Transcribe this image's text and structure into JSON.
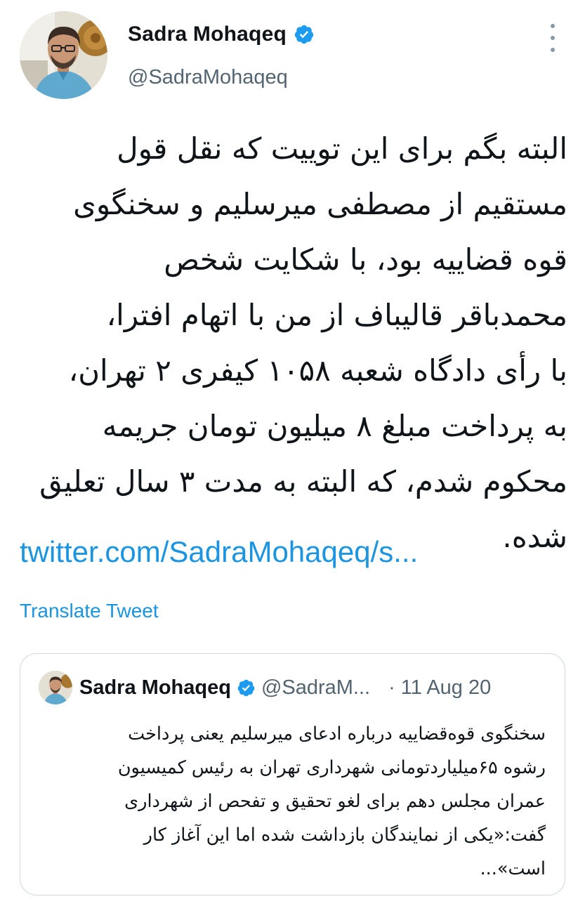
{
  "author": {
    "display_name": "Sadra Mohaqeq",
    "handle": "@SadraMohaqeq",
    "verified": true
  },
  "tweet": {
    "lines": [
      "البته بگم برای این توییت که نقل قول",
      "مستقیم از مصطفی میرسلیم و سخنگوی",
      "قوه قضاییه بود، با شکایت شخص",
      "محمدباقر قالیباف از من با اتهام افترا،",
      "با رأی دادگاه شعبه ۱۰۵۸ کیفری ۲ تهران،",
      "به پرداخت مبلغ ۸ میلیون تومان جریمه",
      "محکوم شدم، که البته به مدت ۳ سال تعلیق",
      "شده."
    ],
    "link": "twitter.com/SadraMohaqeq/s...",
    "translate_label": "Translate Tweet"
  },
  "quoted_tweet": {
    "display_name": "Sadra Mohaqeq",
    "handle": "@SadraM...",
    "separator": "·",
    "date": "11 Aug 20",
    "lines": [
      "سخنگوی قوه‌قضاییه درباره ادعای میرسلیم یعنی پرداخت",
      "رشوه ۶۵میلیاردتومانی شهرداری تهران به رئیس کمیسیون",
      "عمران مجلس دهم برای لغو تحقیق و تفحص از شهرداری",
      "گفت:«یکی از نمایندگان بازداشت شده اما این آغاز کار",
      "است»..."
    ]
  },
  "icons": {
    "verified": "verified-badge-icon",
    "more": "more-vertical-icon"
  },
  "colors": {
    "link": "#1b95e0",
    "verified": "#1d9bf0",
    "secondary_text": "#536471",
    "border": "#cfd9de"
  }
}
